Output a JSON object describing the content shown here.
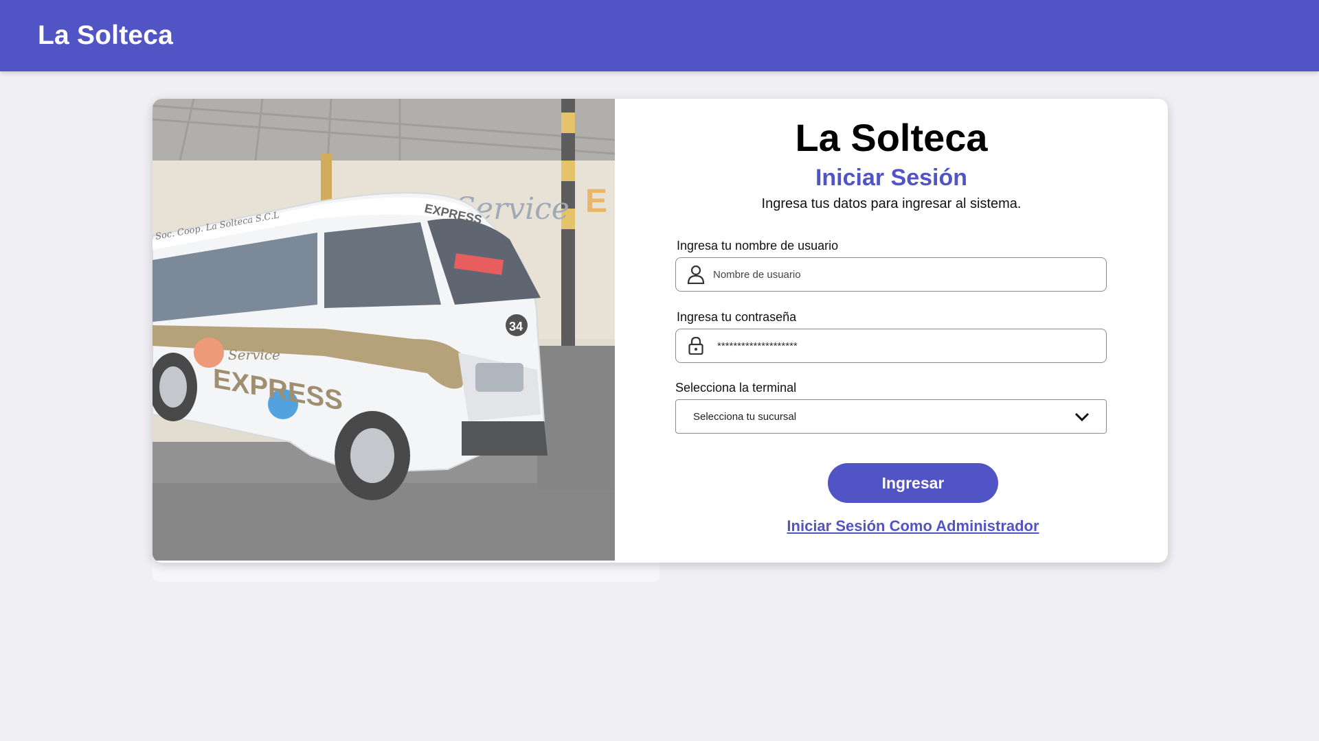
{
  "header": {
    "brand": "La Solteca"
  },
  "photo": {
    "van_texts": {
      "side_logo_top": "Service",
      "side_logo_main": "EXPRESS",
      "window_sign": "EXPRESS",
      "roof_text": "Soc. Coop. La Solteca S.C.L",
      "unit_number": "34",
      "wall_text": "Service"
    }
  },
  "login": {
    "title": "La Solteca",
    "subtitle": "Iniciar Sesión",
    "description": "Ingresa tus datos para ingresar al sistema.",
    "username": {
      "label": "Ingresa tu nombre de usuario",
      "placeholder": "Nombre de usuario",
      "icon": "user-icon"
    },
    "password": {
      "label": "Ingresa tu contraseña",
      "value": "********************",
      "icon": "lock-icon"
    },
    "terminal": {
      "label": "Selecciona la terminal",
      "selected": "Selecciona tu sucursal",
      "icon": "chevron-down-icon"
    },
    "submit_label": "Ingresar",
    "admin_link": "Iniciar Sesión Como Administrador"
  },
  "colors": {
    "accent": "#5154c4",
    "background": "#efeff4",
    "card": "#ffffff"
  }
}
